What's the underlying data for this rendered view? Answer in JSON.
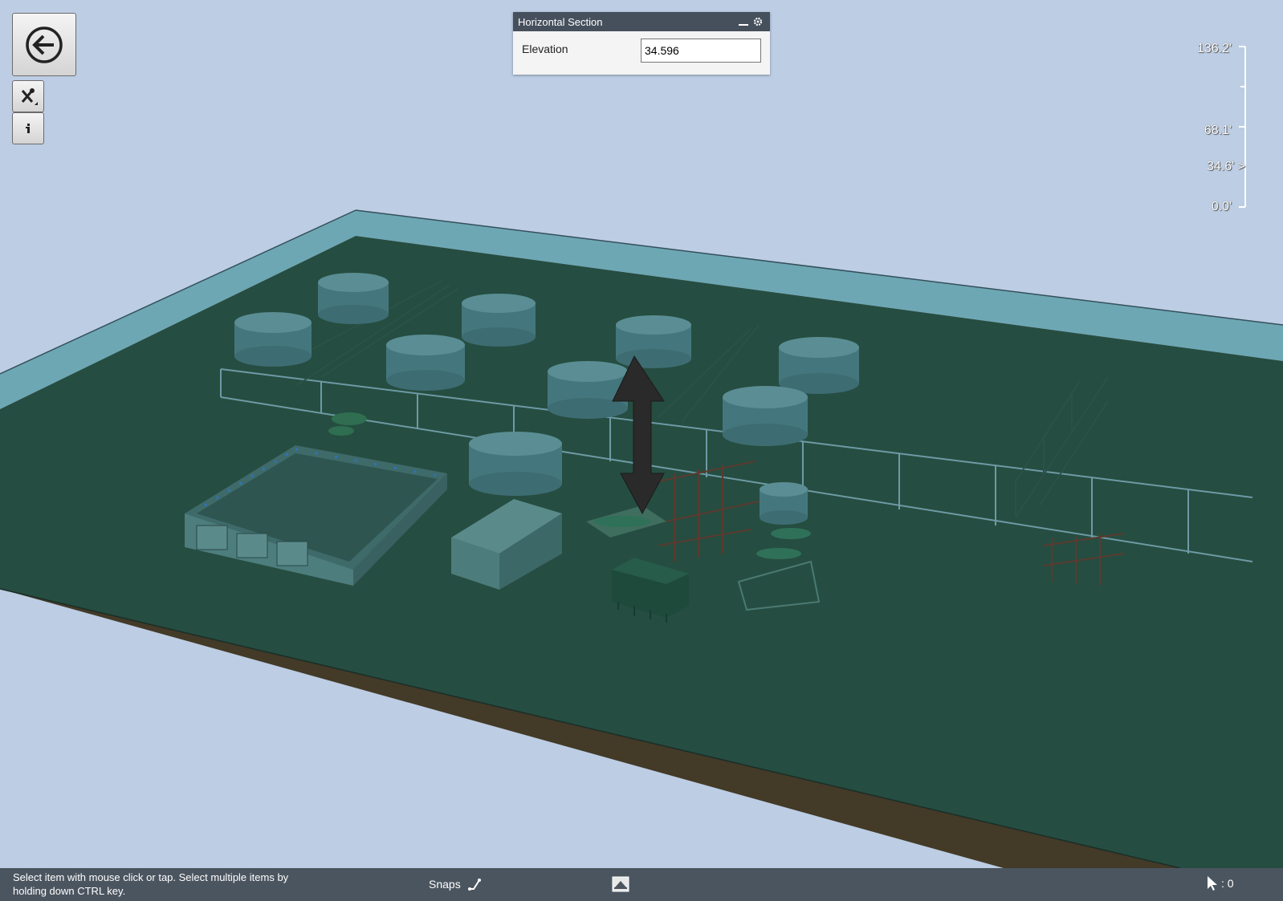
{
  "toolbar": {
    "back_icon": "back-arrow-icon",
    "tools_icon": "tools-icon",
    "info_icon": "info-icon"
  },
  "section_panel": {
    "title": "Horizontal Section",
    "elevation_label": "Elevation",
    "elevation_value": "34.596"
  },
  "elevation_ruler": {
    "labels": [
      "136.2'",
      "68.1'",
      "34.6' >",
      "0.0'"
    ]
  },
  "status_bar": {
    "message": "Select item with mouse click or tap. Select multiple items by holding down CTRL key.",
    "snaps_label": "Snaps",
    "selection_count": ": 0"
  },
  "colors": {
    "sky": "#bccde4",
    "ground": "#264d41",
    "ground_edge": "#6ea7b4",
    "ground_side": "#433a27",
    "status_bar": "#4b5560",
    "panel_title": "#46505c"
  }
}
